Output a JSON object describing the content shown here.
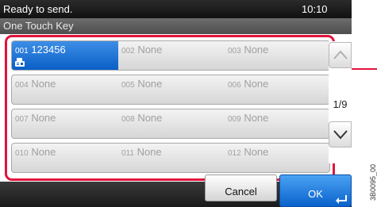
{
  "status": {
    "message": "Ready to send.",
    "time": "10:10"
  },
  "screen_title": "One Touch Key",
  "keys": [
    {
      "number": "001",
      "name": "123456",
      "selected": true,
      "icon": "fax-icon"
    },
    {
      "number": "002",
      "name": "None"
    },
    {
      "number": "003",
      "name": "None"
    },
    {
      "number": "004",
      "name": "None"
    },
    {
      "number": "005",
      "name": "None"
    },
    {
      "number": "006",
      "name": "None"
    },
    {
      "number": "007",
      "name": "None"
    },
    {
      "number": "008",
      "name": "None"
    },
    {
      "number": "009",
      "name": "None"
    },
    {
      "number": "010",
      "name": "None"
    },
    {
      "number": "011",
      "name": "None"
    },
    {
      "number": "012",
      "name": "None"
    }
  ],
  "pager": {
    "page": "1/9",
    "up_icon": "chevron-up-icon",
    "down_icon": "chevron-down-icon"
  },
  "footer": {
    "cancel_label": "Cancel",
    "ok_label": "OK",
    "ok_icon": "enter-icon"
  },
  "reference_code": "3B0095_00",
  "colors": {
    "highlight": "#e0143c",
    "selected_key": "#0a5fc6",
    "status_bar": "#111111"
  }
}
